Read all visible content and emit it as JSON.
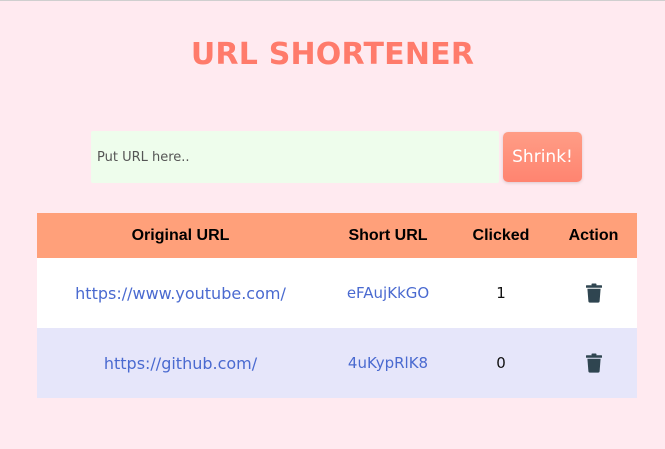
{
  "app": {
    "title": "URL SHORTENER"
  },
  "form": {
    "placeholder": "Put URL here..",
    "value": "",
    "button_label": "Shrink!"
  },
  "table": {
    "headers": [
      "Original URL",
      "Short URL",
      "Clicked",
      "Action"
    ],
    "rows": [
      {
        "original_url": "https://www.youtube.com/",
        "short_url": "eFAujKkGO",
        "clicked": "1",
        "action_icon": "trash-icon"
      },
      {
        "original_url": "https://github.com/",
        "short_url": "4uKypRlK8",
        "clicked": "0",
        "action_icon": "trash-icon"
      }
    ]
  },
  "colors": {
    "background": "#ffeaf0",
    "title": "#ff7b6b",
    "input_bg": "#eefdec",
    "button": "#ff8c78",
    "header_bg": "#ffa07a",
    "row_odd": "#ffffff",
    "row_even": "#e6e6fa",
    "link": "#4a6ad0",
    "icon": "#2f4550"
  }
}
